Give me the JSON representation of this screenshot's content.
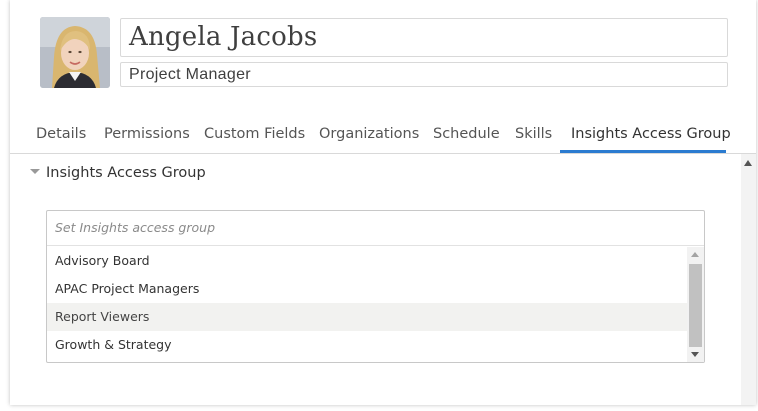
{
  "profile": {
    "name": "Angela Jacobs",
    "job_title": "Project Manager"
  },
  "tabs": [
    {
      "label": "Details",
      "active": false
    },
    {
      "label": "Permissions",
      "active": false
    },
    {
      "label": "Custom Fields",
      "active": false
    },
    {
      "label": "Organizations",
      "active": false
    },
    {
      "label": "Schedule",
      "active": false
    },
    {
      "label": "Skills",
      "active": false
    },
    {
      "label": "Insights Access Group",
      "active": true
    }
  ],
  "section": {
    "title": "Insights Access Group",
    "expanded": true
  },
  "access_group_select": {
    "placeholder": "Set Insights access group",
    "options": [
      {
        "label": "Advisory Board",
        "hovered": false
      },
      {
        "label": "APAC Project Managers",
        "hovered": false
      },
      {
        "label": "Report Viewers",
        "hovered": true
      },
      {
        "label": "Growth & Strategy",
        "hovered": false
      }
    ]
  },
  "colors": {
    "active_tab_accent": "#2b7bd0",
    "hover_row": "#f2f2f0"
  },
  "icons": {
    "section_toggle": "caret-down-icon",
    "scroll_up": "arrow-up-icon",
    "scroll_down": "arrow-down-icon"
  }
}
